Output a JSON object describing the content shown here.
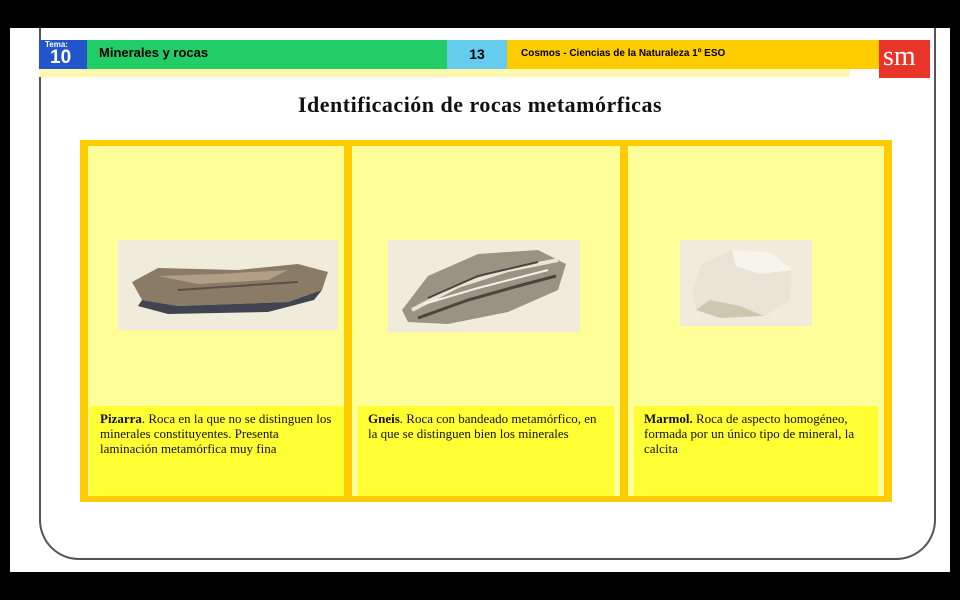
{
  "header": {
    "tema_label": "Tema:",
    "tema_number": "10",
    "topic": "Minerales y rocas",
    "page_number": "13",
    "book": "Cosmos - Ciencias de la Naturaleza 1º ESO",
    "logo": "sm"
  },
  "title": "Identificación de rocas metamórficas",
  "rocks": [
    {
      "name": "Pizarra",
      "desc": ". Roca en la que no se distinguen los minerales constituyentes. Presenta laminación   metamórfica muy fina"
    },
    {
      "name": "Gneis",
      "desc": ". Roca con bandeado metamórfico, en la que se distinguen bien los minerales"
    },
    {
      "name": "Marmol.",
      "desc": " Roca de aspecto homogéneo, formada por un único tipo de mineral, la calcita"
    }
  ],
  "colors": {
    "tema": "#2255cc",
    "topic": "#22cc66",
    "page": "#66ccee",
    "book": "#ffcc00",
    "logo": "#e8352a",
    "panel": "#ffcc00",
    "card": "#ffff99",
    "caption": "#ffff33"
  }
}
